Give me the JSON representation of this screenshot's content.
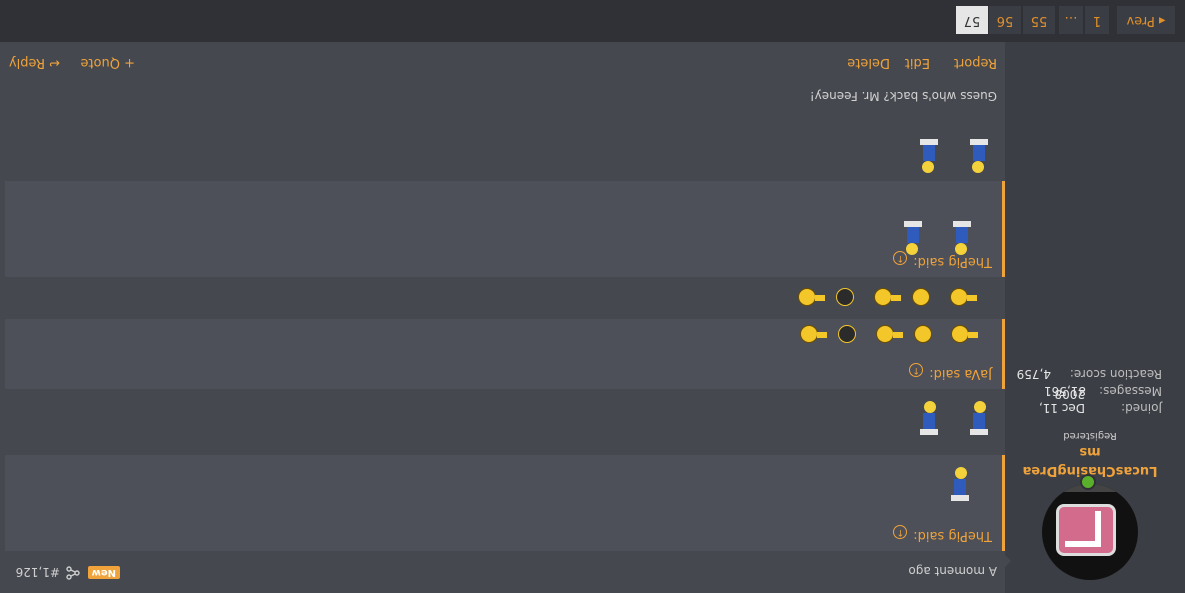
{
  "pagination": {
    "prev_label": "◂ Prev",
    "pages": [
      "1",
      "…",
      "55",
      "56",
      "57"
    ],
    "current": "57"
  },
  "user": {
    "name": "LucasChasingDreams",
    "name_line1": "LucasChasingDrea",
    "name_line2": "ms",
    "title": "Registered",
    "joined_label": "Joined:",
    "joined_value": "Dec 11, 2008",
    "messages_label": "Messages:",
    "messages_value": "81,561",
    "reaction_label": "Reaction score:",
    "reaction_value": "4,759",
    "online": true
  },
  "post": {
    "time": "A moment ago",
    "number": "#1,126",
    "new_badge": "New",
    "text": "Guess who's back? Mr. Feeney!",
    "quotes": [
      {
        "author_said": "ThePig said:"
      },
      {
        "author_said": "JaVa said:"
      },
      {
        "author_said": "ThePig said:"
      }
    ]
  },
  "actions": {
    "report": "Report",
    "edit": "Edit",
    "delete": "Delete",
    "quote": "+ Quote",
    "reply": "↩ Reply"
  },
  "colors": {
    "accent": "#f0a33a",
    "background": "#45484f",
    "quote_bg": "#4d5058"
  }
}
